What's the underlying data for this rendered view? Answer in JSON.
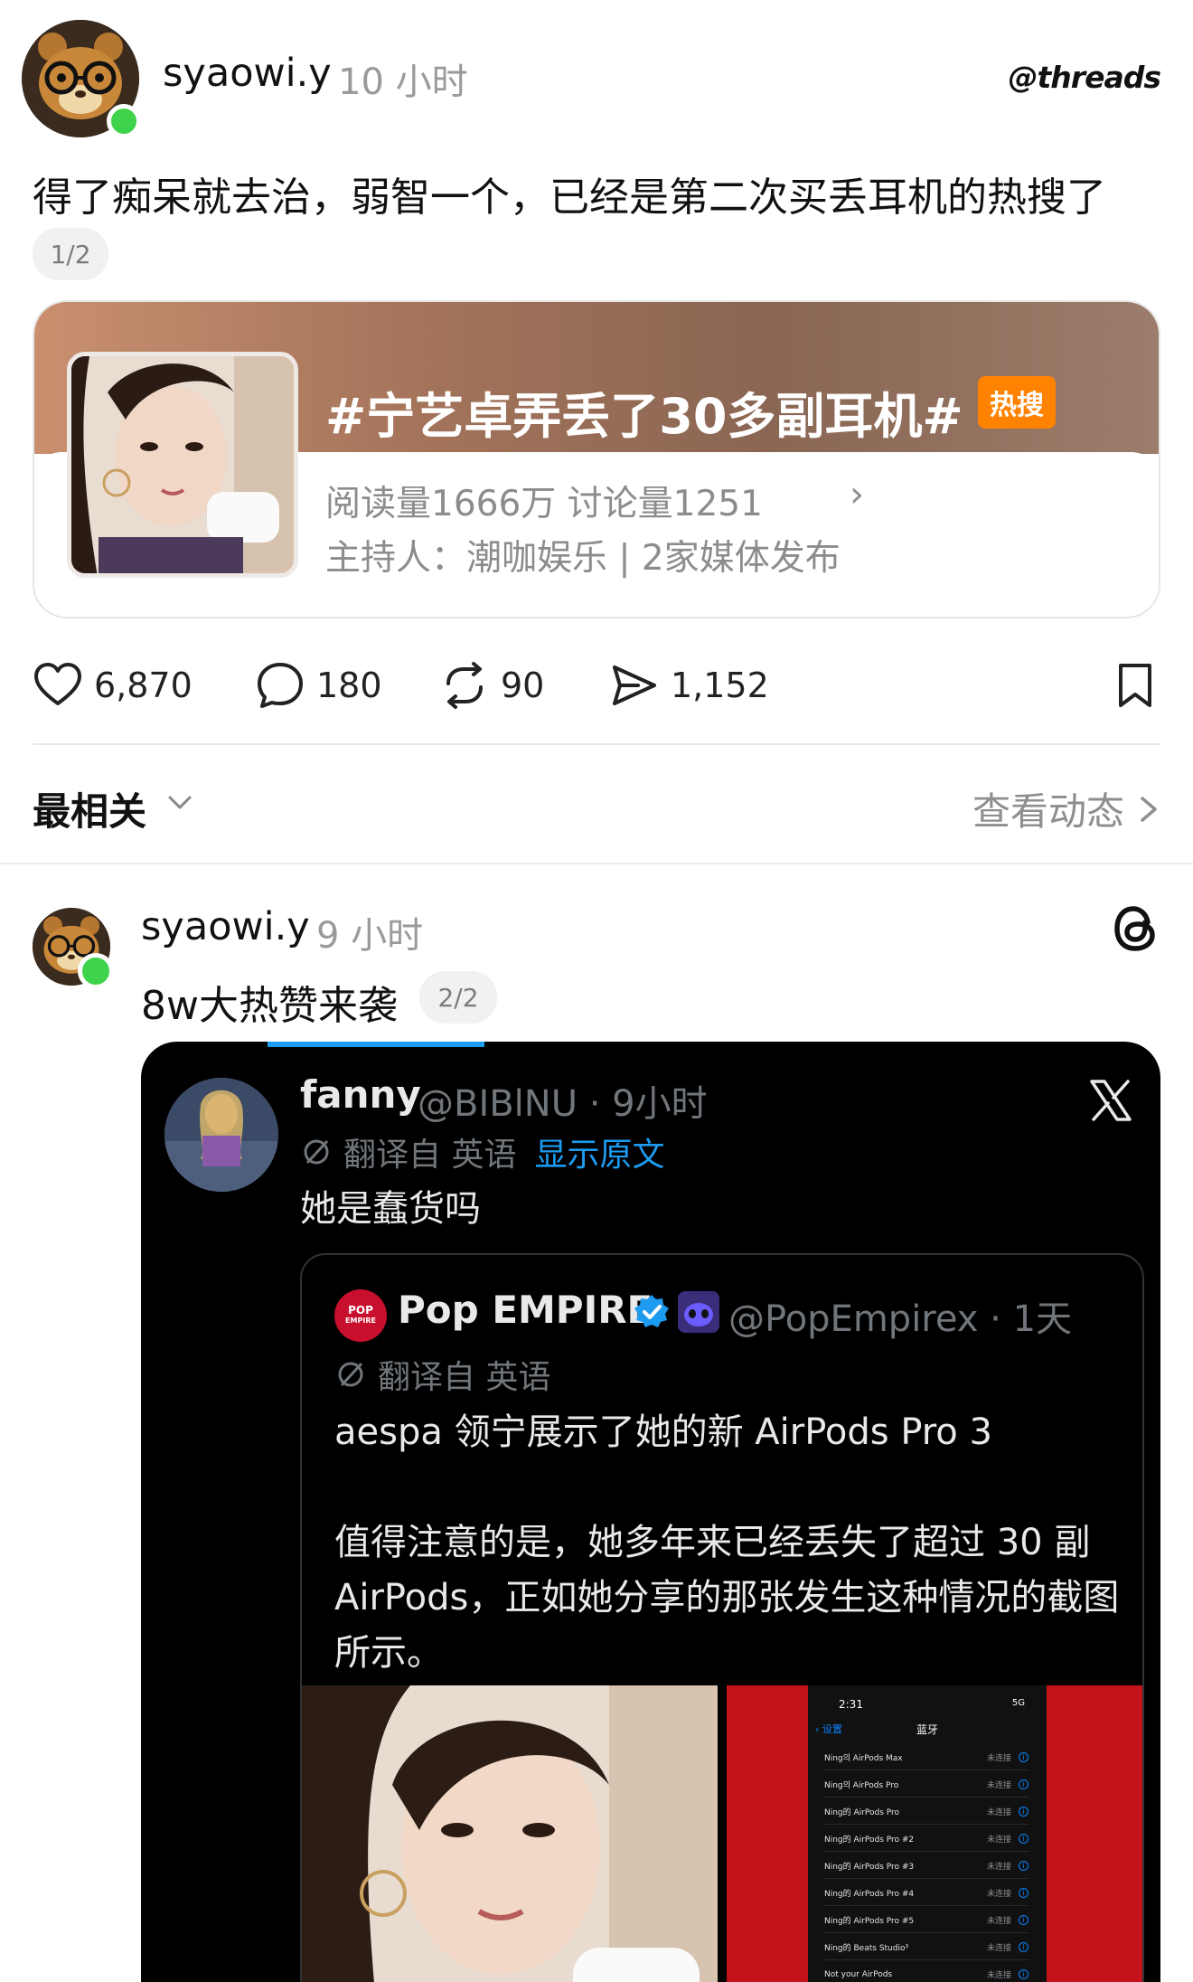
{
  "post1": {
    "username": "syaowi.y",
    "time": "10 小时",
    "brand": "threads",
    "text": "得了痴呆就去治，弱智一个，已经是第二次买丢耳机的热搜了",
    "page_indicator": "1/2"
  },
  "hot_search": {
    "title": "#宁艺卓弄丢了30多副耳机#",
    "badge": "热搜",
    "stats": "阅读量1666万  讨论量1251",
    "host": "主持人：潮咖娱乐 | 2家媒体发布"
  },
  "actions": {
    "likes": "6,870",
    "comments": "180",
    "reposts": "90",
    "shares": "1,152"
  },
  "sort": {
    "label": "最相关",
    "activity_link": "查看动态"
  },
  "post2": {
    "username": "syaowi.y",
    "time": "9 小时",
    "text": "8w大热赞来袭",
    "page_indicator": "2/2"
  },
  "x_post": {
    "name": "fanny",
    "handle": "@BIBlNU · 9小时",
    "translated_from": "翻译自 英语",
    "show_original": "显示原文",
    "text": "她是蠢货吗"
  },
  "quoted_post": {
    "avatar_text_1": "POP",
    "avatar_text_2": "EMPIRE",
    "name": "Pop EMPIRE",
    "handle": "@PopEmpirex · 1天",
    "translated_from": "翻译自 英语",
    "text_line1": "aespa 领宁展示了她的新 AirPods Pro 3",
    "text_line2": "值得注意的是，她多年来已经丢失了超过 30 副 AirPods，正如她分享的那张发生这种情况的截图所示。"
  },
  "phone_screenshot": {
    "time": "2:31",
    "status": "5G",
    "back": "设置",
    "title": "蓝牙",
    "devices": [
      {
        "name": "Ning의 AirPods Max",
        "state": "未连接"
      },
      {
        "name": "Ning의 AirPods Pro",
        "state": "未连接"
      },
      {
        "name": "Ning的 AirPods Pro",
        "state": "未连接"
      },
      {
        "name": "Ning的 AirPods Pro #2",
        "state": "未连接"
      },
      {
        "name": "Ning的 AirPods Pro #3",
        "state": "未连接"
      },
      {
        "name": "Ning的 AirPods Pro #4",
        "state": "未连接"
      },
      {
        "name": "Ning的 AirPods Pro #5",
        "state": "未连接"
      },
      {
        "name": "Ning的 Beats Studio³",
        "state": "未连接"
      },
      {
        "name": "Not your AirPods",
        "state": "未连接"
      }
    ]
  },
  "colors": {
    "online": "#3fd34b",
    "hot_badge": "#ff8200",
    "x_blue": "#1d9bf0",
    "x_bg": "#000000"
  }
}
